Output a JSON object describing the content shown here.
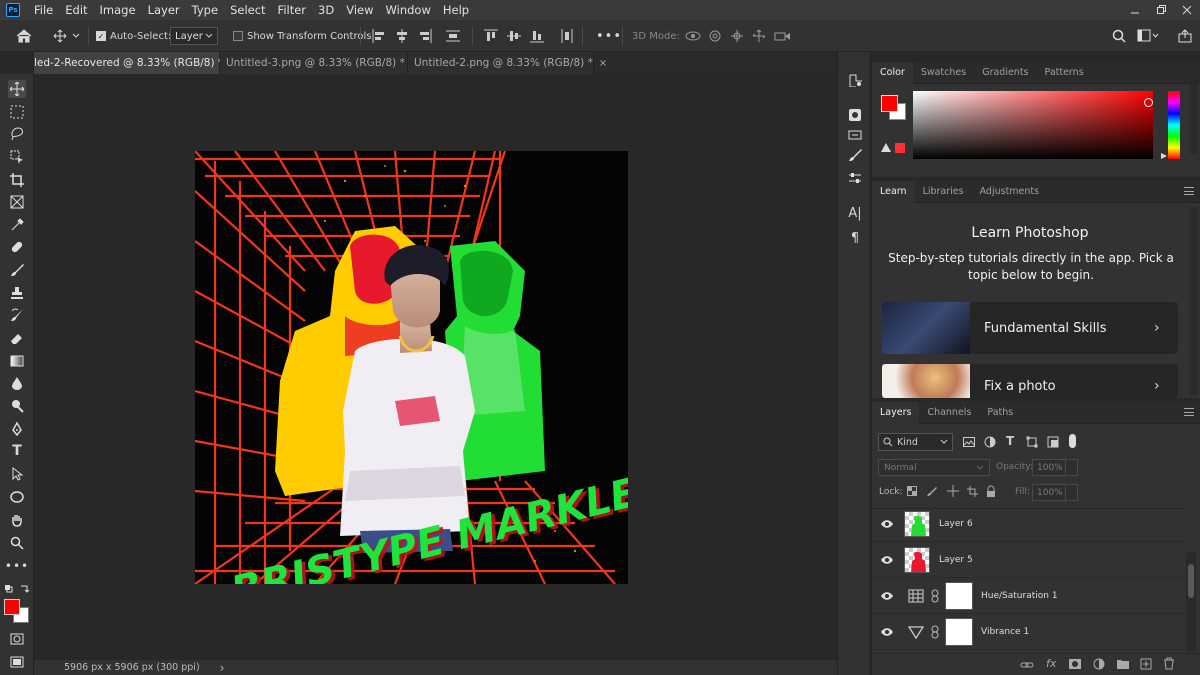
{
  "app": {
    "logo": "Ps"
  },
  "menu": [
    "File",
    "Edit",
    "Image",
    "Layer",
    "Type",
    "Select",
    "Filter",
    "3D",
    "View",
    "Window",
    "Help"
  ],
  "options": {
    "auto_select_label": "Auto-Select:",
    "auto_select_value": "Layer",
    "transform_label": "Show Transform Controls",
    "mode_label": "3D Mode:",
    "more": "•••"
  },
  "tabs": [
    {
      "label": "led-2-Recovered @ 8.33% (RGB/8) *",
      "close": "×"
    },
    {
      "label": "Untitled-3.png @ 8.33% (RGB/8) *",
      "close": "×"
    },
    {
      "label": "Untitled-2.png @ 8.33% (RGB/8) *",
      "close": "×"
    }
  ],
  "status": {
    "dimensions": "5906 px x 5906 px (300 ppi)",
    "arrow": "›"
  },
  "artwork": {
    "text": "BRISTYPE MARKLEE"
  },
  "color_panel": {
    "tabs": [
      "Color",
      "Swatches",
      "Gradients",
      "Patterns"
    ],
    "foreground": "#ff0000",
    "background": "#ffffff"
  },
  "learn_panel": {
    "tabs": [
      "Learn",
      "Libraries",
      "Adjustments"
    ],
    "title": "Learn Photoshop",
    "description": "Step-by-step tutorials directly in the app. Pick a topic below to begin.",
    "cards": [
      {
        "label": "Fundamental Skills",
        "chev": "›"
      },
      {
        "label": "Fix a photo",
        "chev": "›"
      }
    ]
  },
  "layers_panel": {
    "tabs": [
      "Layers",
      "Channels",
      "Paths"
    ],
    "filter_kind": "Kind",
    "blend_mode": "Normal",
    "opacity_label": "Opacity:",
    "opacity_value": "100%",
    "lock_label": "Lock:",
    "fill_label": "Fill:",
    "fill_value": "100%",
    "layers": [
      {
        "name": "Layer 6",
        "thumb": "green"
      },
      {
        "name": "Layer 5",
        "thumb": "red"
      },
      {
        "name": "Hue/Saturation 1",
        "thumb": "hue"
      },
      {
        "name": "Vibrance 1",
        "thumb": "vibrance"
      }
    ]
  }
}
